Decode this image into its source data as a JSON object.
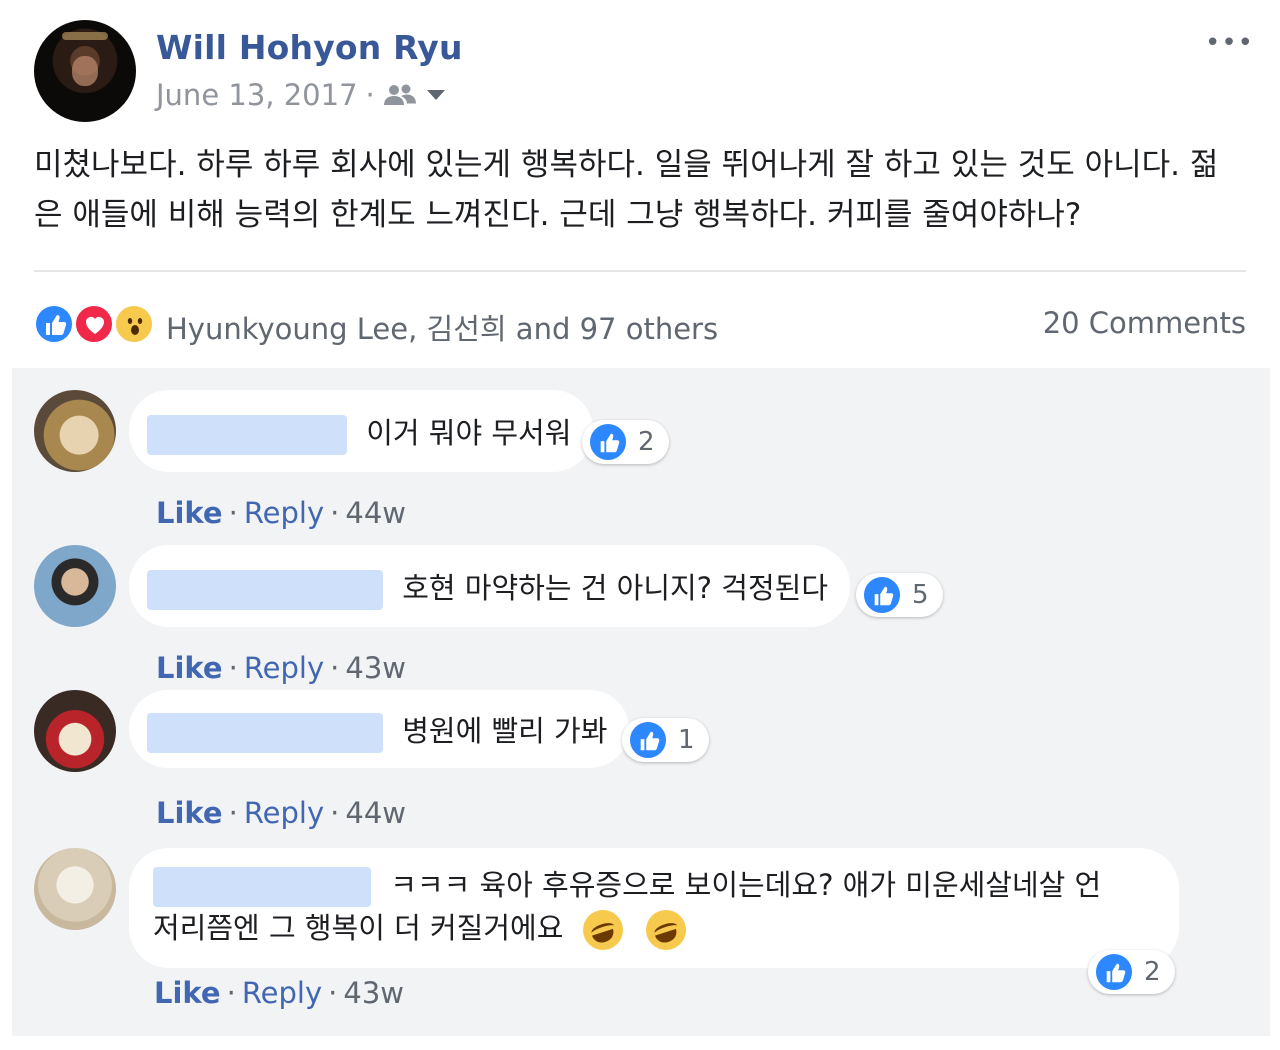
{
  "post": {
    "author": "Will Hohyon Ryu",
    "date": "June 13, 2017",
    "separator": "·",
    "more": "•••",
    "text": "미쳤나보다. 하루 하루 회사에 있는게 행복하다. 일을 뛰어나게 잘 하고 있는 것도 아니다. 젊은 애들에 비해 능력의 한계도 느껴진다. 근데 그냥 행복하다. 커피를 줄여야하나?"
  },
  "reactions": {
    "icons": [
      "like-icon",
      "love-icon",
      "wow-icon"
    ],
    "names": "Hyunkyoung Lee, 김선희 and 97 others",
    "comments_count": "20 Comments"
  },
  "comments": [
    {
      "text": "이거 뭐야 무서워",
      "likes": "2",
      "like_label": "Like",
      "reply_label": "Reply",
      "time": "44w"
    },
    {
      "text": "호현 마약하는 건 아니지? 걱정된다",
      "likes": "5",
      "like_label": "Like",
      "reply_label": "Reply",
      "time": "43w"
    },
    {
      "text": "병원에 빨리 가봐",
      "likes": "1",
      "like_label": "Like",
      "reply_label": "Reply",
      "time": "44w"
    },
    {
      "text_line1": "ㅋㅋㅋ 육아 후유증으로 보이는데요? 애가 미운세살네살 언",
      "text_line2": "저리쯤엔 그 행복이 더 커질거에요",
      "likes": "2",
      "like_label": "Like",
      "reply_label": "Reply",
      "time": "43w"
    }
  ],
  "colors": {
    "link": "#385898",
    "like_blue": "#2d88ff",
    "comment_bg": "#f2f3f5"
  }
}
